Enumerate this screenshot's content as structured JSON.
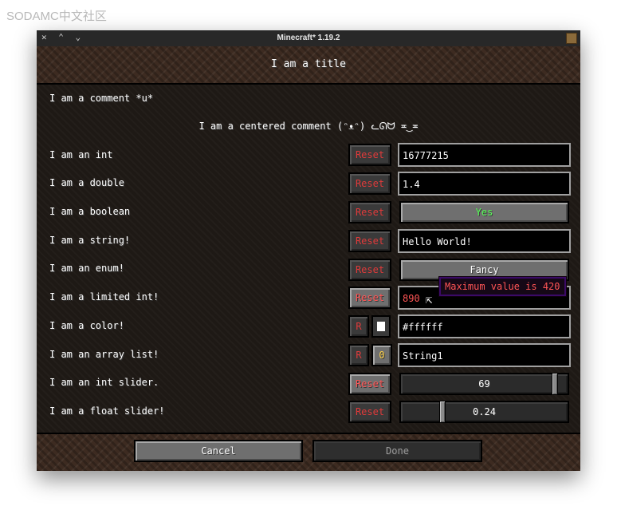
{
  "watermark": "SODAMC中文社区",
  "window": {
    "title": "Minecraft* 1.19.2",
    "controls": "✕ ⌃ ⌄"
  },
  "screen": {
    "title": "I am a title",
    "comment": "I am a comment *u*",
    "centered_comment": "I am a centered comment (ᵔᴥᵔ) ᓚᘏᗢ ≖‿≖"
  },
  "rows": [
    {
      "label": "I am an int",
      "reset": "Reset",
      "value": "16777215"
    },
    {
      "label": "I am a double",
      "reset": "Reset",
      "value": "1.4"
    },
    {
      "label": "I am a boolean",
      "reset": "Reset",
      "value": "Yes"
    },
    {
      "label": "I am a string!",
      "reset": "Reset",
      "value": "Hello World!"
    },
    {
      "label": "I am an enum!",
      "reset": "Reset",
      "value": "Fancy"
    },
    {
      "label": "I am a limited int!",
      "reset": "Reset",
      "value": "890"
    },
    {
      "label": "I am a color!",
      "reset": "R",
      "value": "#ffffff",
      "swatch_color": "#ffffff"
    },
    {
      "label": "I am an array list!",
      "reset": "R",
      "count": "0",
      "value": "String1"
    },
    {
      "label": "I am an int slider.",
      "reset": "Reset",
      "value": "69",
      "fraction": 0.94
    },
    {
      "label": "I am a float slider!",
      "reset": "Reset",
      "value": "0.24",
      "fraction": 0.24
    }
  ],
  "tooltip": "Maximum value is 420",
  "footer": {
    "cancel": "Cancel",
    "done": "Done"
  },
  "colors": {
    "reset_text": "#e03a3a",
    "boolean_yes": "#55ff55",
    "error_text": "#ff5555",
    "counter_text": "#ffd24a"
  }
}
